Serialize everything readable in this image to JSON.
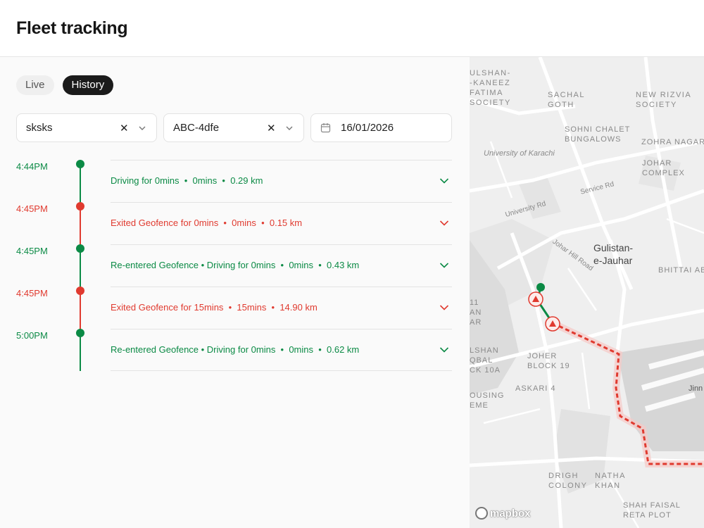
{
  "header": {
    "title": "Fleet tracking"
  },
  "tabs": [
    {
      "label": "Live",
      "active": false
    },
    {
      "label": "History",
      "active": true
    }
  ],
  "filters": {
    "driver": {
      "value": "sksks"
    },
    "vehicle": {
      "value": "ABC-4dfe"
    },
    "date": {
      "value": "16/01/2026"
    },
    "clear_glyph": "✕"
  },
  "timeline": [
    {
      "time": "4:44PM",
      "status": "green",
      "text": "Driving for 0mins  •  0mins  •  0.29 km"
    },
    {
      "time": "4:45PM",
      "status": "red",
      "text": "Exited Geofence for 0mins  •  0mins  •  0.15 km"
    },
    {
      "time": "4:45PM",
      "status": "green",
      "text": "Re-entered Geofence • Driving for 0mins  •  0mins  •  0.43 km"
    },
    {
      "time": "4:45PM",
      "status": "red",
      "text": "Exited Geofence for 15mins  •  15mins  •  14.90 km"
    },
    {
      "time": "5:00PM",
      "status": "green",
      "text": "Re-entered Geofence • Driving for 0mins  •  0mins  •  0.62 km"
    }
  ],
  "colors": {
    "green": "#0b8a45",
    "red": "#e03a2f"
  },
  "map": {
    "labels": {
      "gulshan_kaneez": "ULSHAN-\n-KANEEZ\nFATIMA\nSOCIETY",
      "sachal_goth": "SACHAL\nGOTH",
      "new_rizvia": "NEW RIZVIA\nSOCIETY",
      "sohni_chalet": "SOHNI CHALET\nBUNGALOWS",
      "zohra_nagar": "ZOHRA NAGAR",
      "uni_karachi": "University of Karachi",
      "johar_complex": "JOHAR\nCOMPLEX",
      "service_rd": "Service Rd",
      "university_rd": "University Rd",
      "johar_hill": "Johar Hill Road",
      "gulistan": "Gulistan-\ne-Jauhar",
      "bhittai": "BHITTAI ABA",
      "block11": "11\nAN\nAR",
      "gulshan_iqbal": "LSHAN\nQBAL\nCK 10A",
      "johar_block19": "JOHER\nBLOCK 19",
      "askari": "ASKARI 4",
      "housing": "OUSING\nEME",
      "jinn": "Jinn",
      "drigh": "DRIGH\nCOLONY",
      "natha": "NATHA\nKHAN",
      "shah_faisal": "SHAH FAISAL\nRETA PLOT",
      "mapbox": "mapbox"
    }
  }
}
